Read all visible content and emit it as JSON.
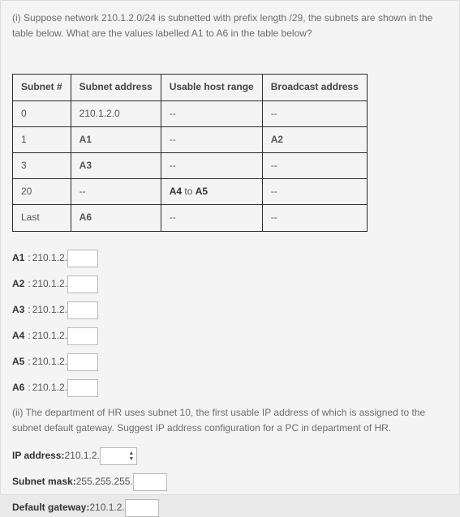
{
  "question_i": "(i) Suppose network 210.1.2.0/24 is subnetted with prefix length /29, the subnets are shown in the table below. What are the values labelled A1 to A6 in the table below?",
  "table": {
    "headers": [
      "Subnet #",
      "Subnet address",
      "Usable host range",
      "Broadcast address"
    ],
    "rows": [
      {
        "num": "0",
        "addr": "210.1.2.0",
        "range": "--",
        "bcast": "--"
      },
      {
        "num": "1",
        "addr": "A1",
        "range": "--",
        "bcast": "A2",
        "addr_bold": true,
        "bcast_bold": true
      },
      {
        "num": "3",
        "addr": "A3",
        "range": "--",
        "bcast": "--",
        "addr_bold": true
      },
      {
        "num": "20",
        "addr": "--",
        "range_pre": "A4",
        "range_mid": " to ",
        "range_post": "A5",
        "bcast": "--"
      },
      {
        "num": "Last",
        "addr": "A6",
        "range": "--",
        "bcast": "--",
        "addr_bold": true
      }
    ]
  },
  "answers": {
    "prefix": "210.1.2.",
    "items": [
      {
        "label": "A1"
      },
      {
        "label": "A2"
      },
      {
        "label": "A3"
      },
      {
        "label": "A4"
      },
      {
        "label": "A5"
      },
      {
        "label": "A6"
      }
    ]
  },
  "question_ii": "(ii) The department of HR uses subnet 10, the first usable IP address of which is assigned to the subnet default gateway. Suggest IP address configuration for a PC in department of HR.",
  "config": {
    "ip_label": "IP address:",
    "ip_prefix": "210.1.2.",
    "mask_label": "Subnet mask:",
    "mask_prefix": "255.255.255.",
    "gw_label": "Default gateway:",
    "gw_prefix": "210.1.2."
  }
}
